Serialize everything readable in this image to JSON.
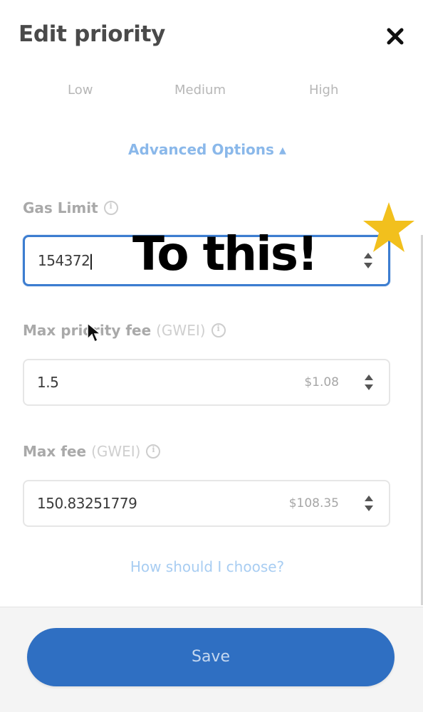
{
  "header": {
    "title": "Edit priority",
    "close_icon": "close-icon"
  },
  "tabs": [
    {
      "label": "Low"
    },
    {
      "label": "Medium"
    },
    {
      "label": "High"
    }
  ],
  "advanced": {
    "label": "Advanced Options ▴"
  },
  "fields": {
    "gas_limit": {
      "label": "Gas Limit",
      "value": "154372"
    },
    "max_priority_fee": {
      "label": "Max priority fee",
      "unit": "(GWEI)",
      "value": "1.5",
      "fiat": "$1.08"
    },
    "max_fee": {
      "label": "Max fee",
      "unit": "(GWEI)",
      "value": "150.83251779",
      "fiat": "$108.35"
    }
  },
  "overlay": {
    "text": "To this!",
    "star_color": "#f2c01d"
  },
  "help_link": "How should I choose?",
  "footer": {
    "save_label": "Save"
  },
  "colors": {
    "accent": "#2f6fc2",
    "focus_border": "#3c7dd0",
    "link": "#8ab8ea"
  }
}
